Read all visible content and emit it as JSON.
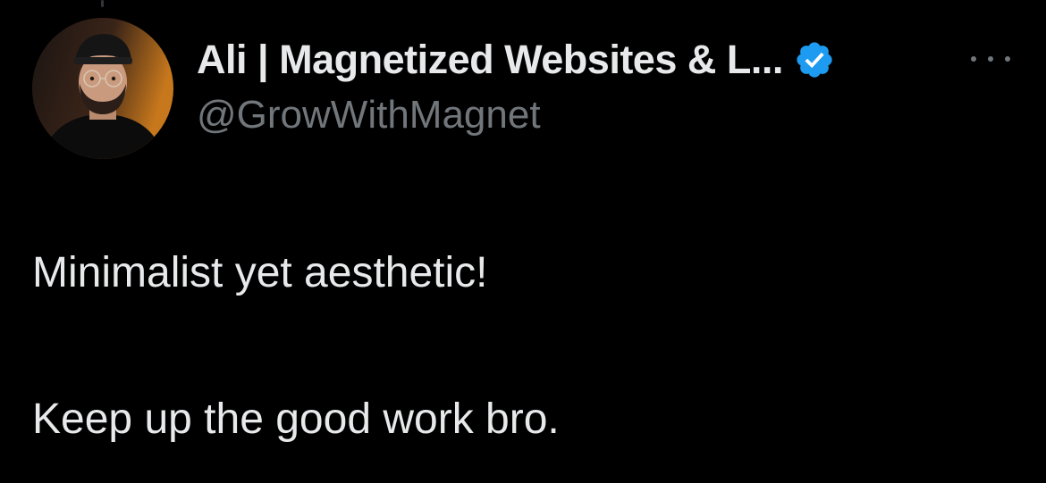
{
  "tweet": {
    "author": {
      "display_name": "Ali | Magnetized Websites & L...",
      "handle": "@GrowWithMagnet",
      "verified": true,
      "avatar_icon": "profile-photo"
    },
    "more_icon": "ellipsis-icon",
    "text_lines": [
      "Minimalist yet aesthetic!",
      "Keep up the good work bro."
    ]
  },
  "colors": {
    "background": "#000000",
    "primary_text": "#e7e9ea",
    "secondary_text": "#71767b",
    "verified_blue": "#1d9bf0"
  }
}
